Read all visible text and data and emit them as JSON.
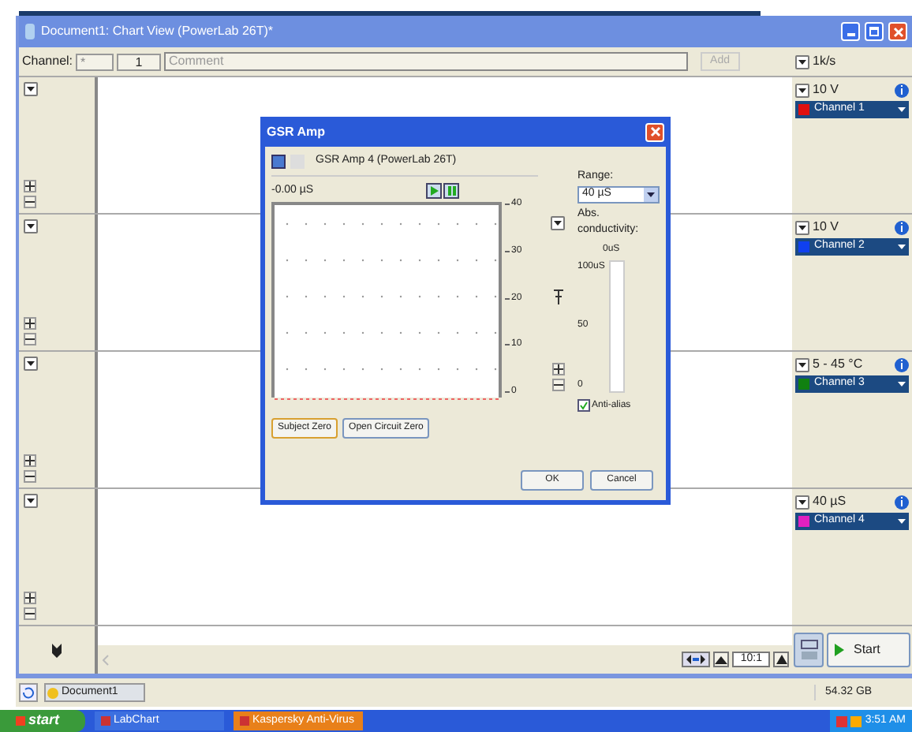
{
  "window": {
    "title": "Document1: Chart View (PowerLab 26T)*"
  },
  "toolbar": {
    "channel_label": "Channel:",
    "channel_value": "*",
    "page_value": "1",
    "comment_placeholder": "Comment",
    "add_button": {
      "label": "Add",
      "disabled": true
    },
    "rate": "1k/s"
  },
  "channels": [
    {
      "range": "10 V",
      "name": "Channel 1",
      "color": "#e01010"
    },
    {
      "range": "10 V",
      "name": "Channel 2",
      "color": "#1040f0"
    },
    {
      "range": "5 - 45 °C",
      "name": "Channel 3",
      "color": "#108010"
    },
    {
      "range": "40 µS",
      "name": "Channel 4",
      "color": "#e020c0"
    }
  ],
  "bottom_bar": {
    "zoom": "10:1",
    "start_button": "Start"
  },
  "status_bar": {
    "document": "Document1",
    "disk": "54.32 GB"
  },
  "taskbar": {
    "start": "start",
    "tasks": [
      {
        "label": "LabChart",
        "flashing": false
      },
      {
        "label": "Kaspersky Anti-Virus",
        "flashing": true
      }
    ],
    "clock": "3:51 AM"
  },
  "dialog": {
    "title": "GSR Amp",
    "device": "GSR Amp 4 (PowerLab 26T)",
    "reading": "-0.00 µS",
    "yticks": [
      "40",
      "30",
      "20",
      "10",
      "0"
    ],
    "range_label": "Range:",
    "range_value": "40 µS",
    "abs_label": "Abs. conductivity:",
    "abs_value": "0uS",
    "meter_labels": [
      "100uS",
      "50",
      "0"
    ],
    "meter": {
      "level": 0
    },
    "anti_alias": {
      "label": "Anti-alias",
      "checked": true
    },
    "zero_buttons": [
      {
        "label": "Subject Zero",
        "selected": true
      },
      {
        "label": "Open Circuit Zero",
        "selected": false
      }
    ],
    "buttons": [
      "OK",
      "Cancel"
    ]
  }
}
